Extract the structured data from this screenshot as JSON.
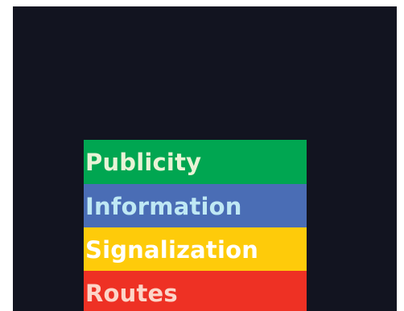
{
  "menu": {
    "items": [
      {
        "label": "Publicity",
        "background": "#00a651",
        "color": "#e8f3d6"
      },
      {
        "label": "Information",
        "background": "#4a6db5",
        "color": "#bfe8f4"
      },
      {
        "label": "Signalization",
        "background": "#fecb0a",
        "color": "#ffffff"
      },
      {
        "label": "Routes",
        "background": "#ee3124",
        "color": "#fcd5c8"
      }
    ]
  }
}
